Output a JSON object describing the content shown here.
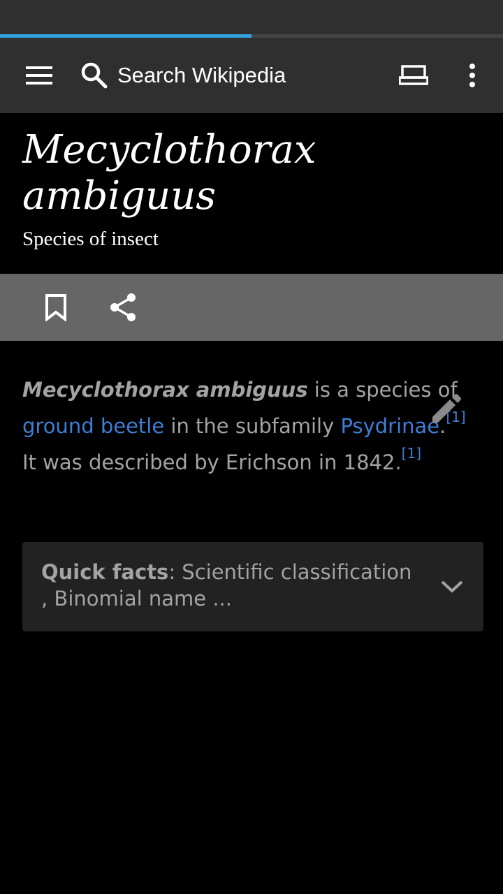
{
  "load_progress": 0.5,
  "colors": {
    "toolbar_bg": "#2f2f2f",
    "progress": "#36a2dd",
    "action_bar_bg": "#666666",
    "link": "#3e7ed5",
    "body_text": "#a3a3a3"
  },
  "toolbar": {
    "menu_icon": "hamburger-menu-icon",
    "search_icon": "search-icon",
    "search_placeholder": "Search Wikipedia",
    "reading_mode_icon": "reading-mode-icon",
    "overflow_icon": "more-vert-icon"
  },
  "article": {
    "title": "Mecyclothorax ambiguus",
    "description": "Species of insect",
    "actions": {
      "bookmark_icon": "bookmark-icon",
      "share_icon": "share-icon",
      "edit_icon": "edit-pencil-icon"
    },
    "lead": {
      "bold_title": "Mecyclothorax ambiguus",
      "text_1": " is a species of ",
      "link_1": "ground beetle",
      "text_2": " in the subfamily ",
      "link_2": "Psydrinae",
      "text_3": ".",
      "ref_1": "[1]",
      "text_4": " It was described by Erichson in 1842.",
      "ref_2": "[1]"
    },
    "quick_facts": {
      "label": "Quick facts",
      "summary": ": Scientific classification , Binomial name ...",
      "chevron_icon": "chevron-down-icon"
    }
  }
}
